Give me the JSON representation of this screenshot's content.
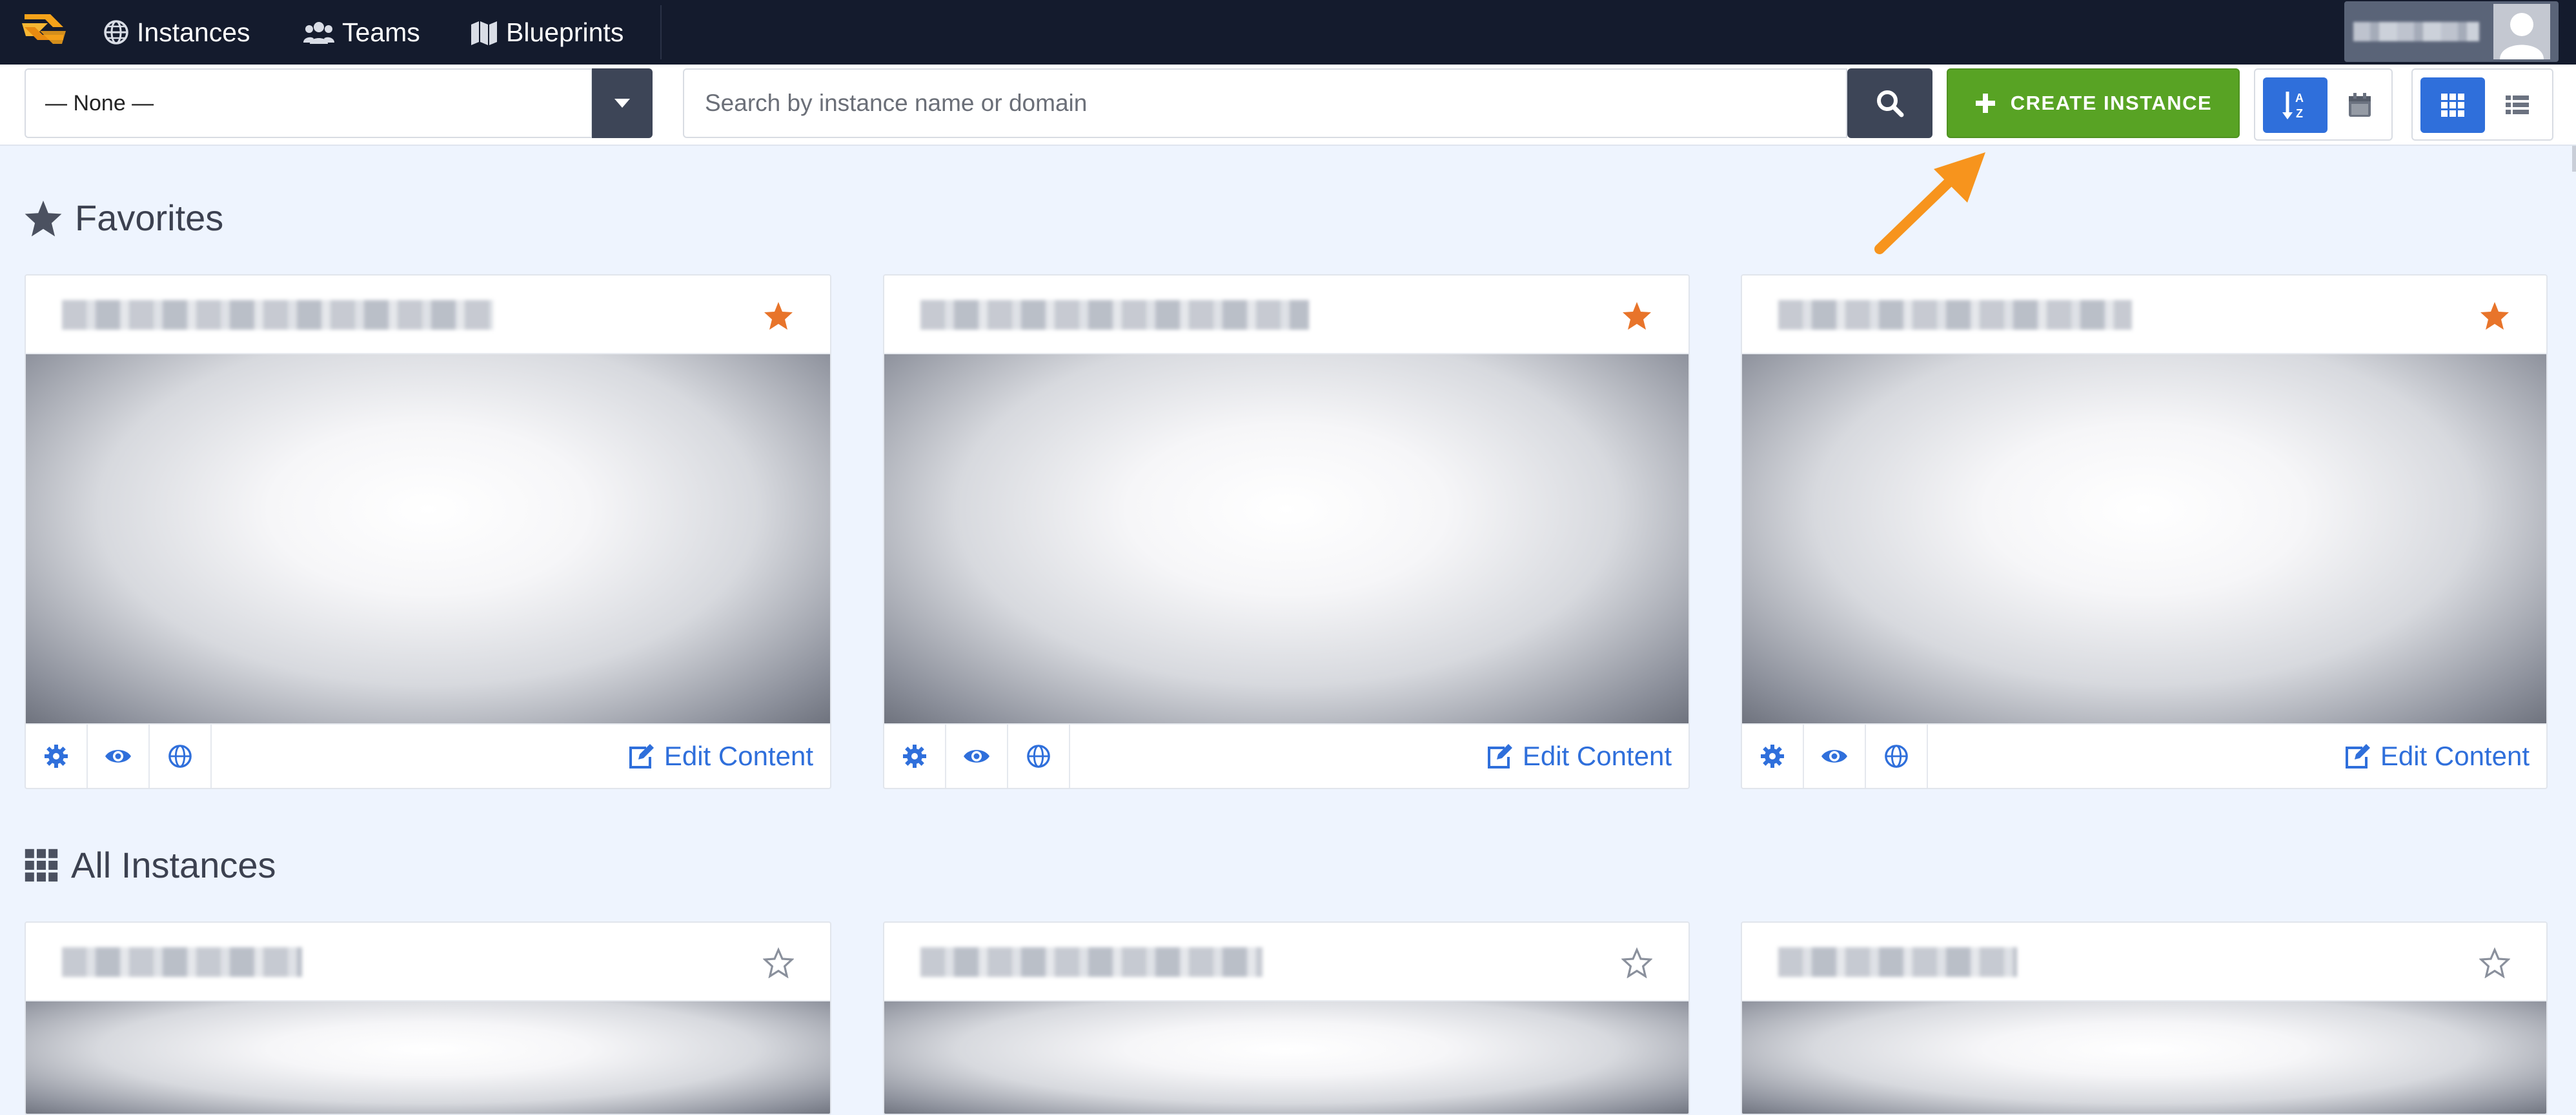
{
  "navbar": {
    "items": [
      {
        "label": "Instances",
        "icon": "globe-icon"
      },
      {
        "label": "Teams",
        "icon": "users-icon"
      },
      {
        "label": "Blueprints",
        "icon": "map-icon"
      }
    ]
  },
  "toolbar": {
    "filter_value": "— None —",
    "search_placeholder": "Search by instance name or domain",
    "create_label": "CREATE INSTANCE"
  },
  "sections": {
    "favorites_title": "Favorites",
    "all_title": "All Instances"
  },
  "cards": {
    "edit_label": "Edit Content"
  },
  "colors": {
    "navbar_bg": "#141b2d",
    "create_green": "#58a324",
    "accent_blue": "#2f6fdb",
    "favorite_star": "#e8742a",
    "arrow_orange": "#f7941d"
  }
}
